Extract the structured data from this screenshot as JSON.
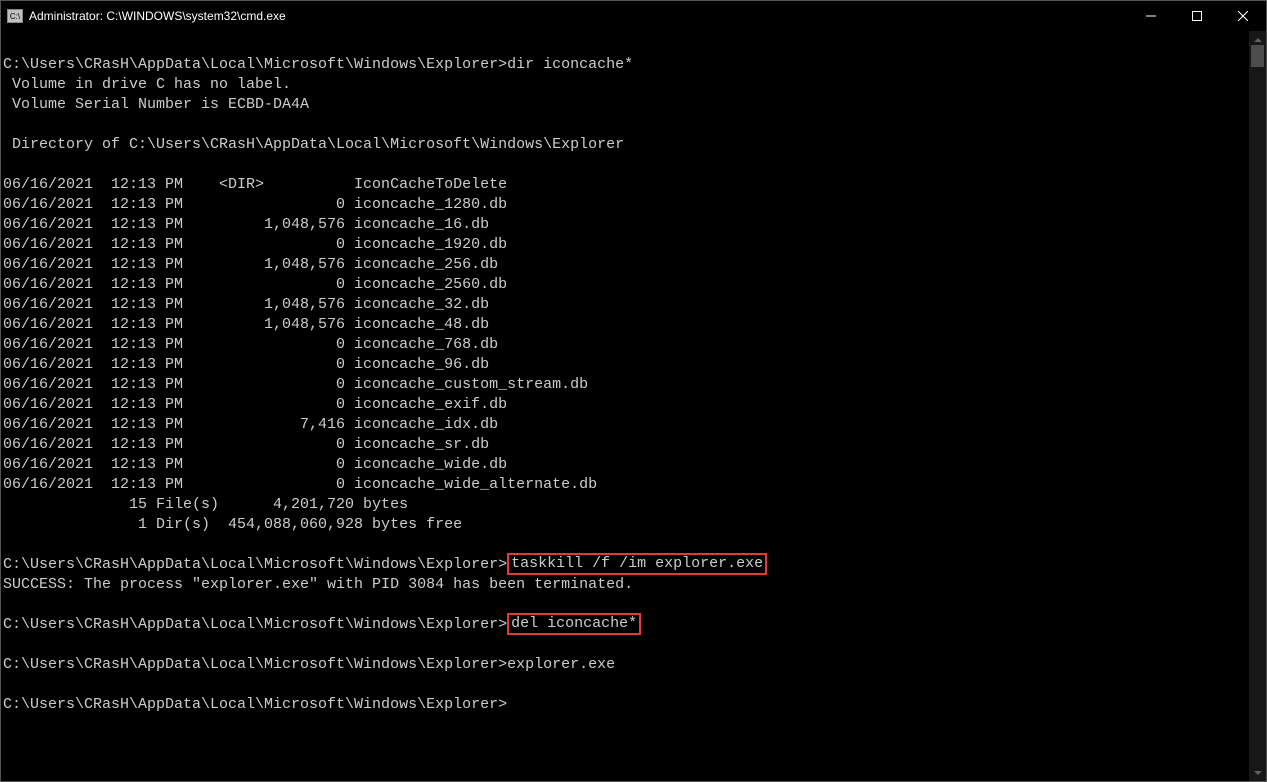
{
  "titlebar": {
    "icon_label": "C:\\",
    "title": "Administrator: C:\\WINDOWS\\system32\\cmd.exe"
  },
  "terminal": {
    "blank_top": "",
    "line_prompt1": "C:\\Users\\CRasH\\AppData\\Local\\Microsoft\\Windows\\Explorer>dir iconcache*",
    "vol_line": " Volume in drive C has no label.",
    "serial_line": " Volume Serial Number is ECBD-DA4A",
    "blank1": "",
    "dir_of": " Directory of C:\\Users\\CRasH\\AppData\\Local\\Microsoft\\Windows\\Explorer",
    "blank2": "",
    "entries": [
      "06/16/2021  12:13 PM    <DIR>          IconCacheToDelete",
      "06/16/2021  12:13 PM                 0 iconcache_1280.db",
      "06/16/2021  12:13 PM         1,048,576 iconcache_16.db",
      "06/16/2021  12:13 PM                 0 iconcache_1920.db",
      "06/16/2021  12:13 PM         1,048,576 iconcache_256.db",
      "06/16/2021  12:13 PM                 0 iconcache_2560.db",
      "06/16/2021  12:13 PM         1,048,576 iconcache_32.db",
      "06/16/2021  12:13 PM         1,048,576 iconcache_48.db",
      "06/16/2021  12:13 PM                 0 iconcache_768.db",
      "06/16/2021  12:13 PM                 0 iconcache_96.db",
      "06/16/2021  12:13 PM                 0 iconcache_custom_stream.db",
      "06/16/2021  12:13 PM                 0 iconcache_exif.db",
      "06/16/2021  12:13 PM             7,416 iconcache_idx.db",
      "06/16/2021  12:13 PM                 0 iconcache_sr.db",
      "06/16/2021  12:13 PM                 0 iconcache_wide.db",
      "06/16/2021  12:13 PM                 0 iconcache_wide_alternate.db"
    ],
    "summary_files": "              15 File(s)      4,201,720 bytes",
    "summary_dirs": "               1 Dir(s)  454,088,060,928 bytes free",
    "blank3": "",
    "prompt2_prefix": "C:\\Users\\CRasH\\AppData\\Local\\Microsoft\\Windows\\Explorer>",
    "prompt2_cmd": "taskkill /f /im explorer.exe",
    "taskkill_result": "SUCCESS: The process \"explorer.exe\" with PID 3084 has been terminated.",
    "blank4": "",
    "prompt3_prefix": "C:\\Users\\CRasH\\AppData\\Local\\Microsoft\\Windows\\Explorer>",
    "prompt3_cmd": "del iconcache*",
    "blank5": "",
    "prompt4": "C:\\Users\\CRasH\\AppData\\Local\\Microsoft\\Windows\\Explorer>explorer.exe",
    "blank6": "",
    "prompt5": "C:\\Users\\CRasH\\AppData\\Local\\Microsoft\\Windows\\Explorer>"
  }
}
